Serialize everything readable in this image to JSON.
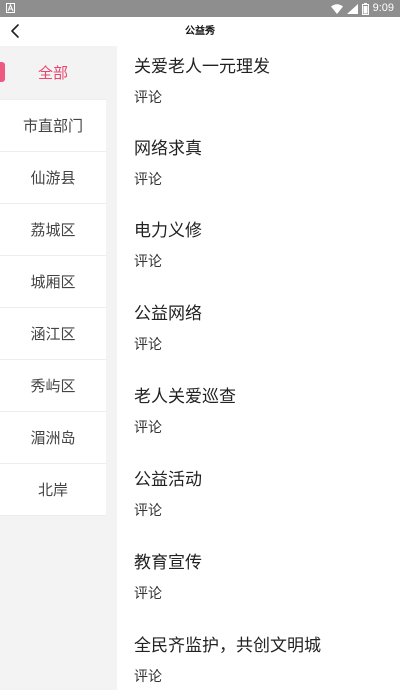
{
  "status_bar": {
    "time": "9:09"
  },
  "header": {
    "title": "公益秀"
  },
  "sidebar": {
    "items": [
      {
        "label": "全部",
        "active": true
      },
      {
        "label": "市直部门"
      },
      {
        "label": "仙游县"
      },
      {
        "label": "荔城区"
      },
      {
        "label": "城厢区"
      },
      {
        "label": "涵江区"
      },
      {
        "label": "秀屿区"
      },
      {
        "label": "湄洲岛"
      },
      {
        "label": "北岸"
      }
    ]
  },
  "articles": [
    {
      "title": "关爱老人一元理发",
      "action": "评论"
    },
    {
      "title": "网络求真",
      "action": "评论"
    },
    {
      "title": "电力义修",
      "action": "评论"
    },
    {
      "title": "公益网络",
      "action": "评论"
    },
    {
      "title": "老人关爱巡查",
      "action": "评论"
    },
    {
      "title": "公益活动",
      "action": "评论"
    },
    {
      "title": "教育宣传",
      "action": "评论"
    },
    {
      "title": "全民齐监护，共创文明城",
      "action": "评论"
    }
  ],
  "colors": {
    "accent": "#e8466e",
    "status_bar": "#8e8e8e",
    "sidebar_bg": "#f3f3f3"
  }
}
